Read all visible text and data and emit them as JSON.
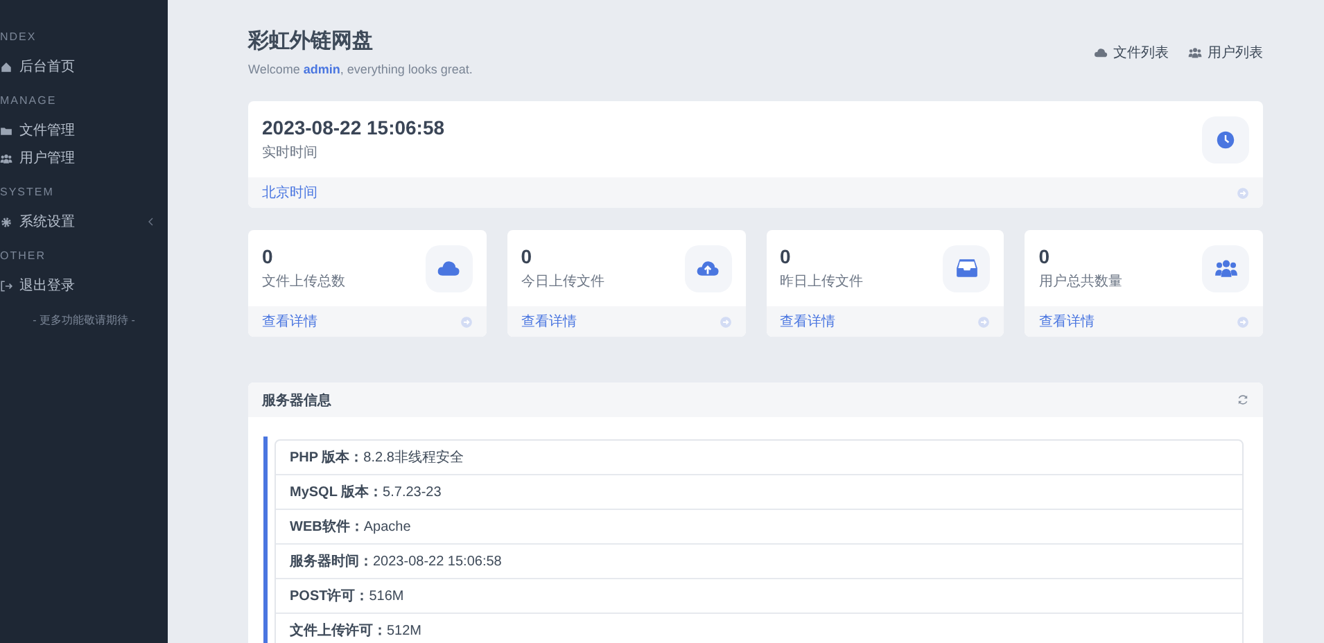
{
  "sidebar": {
    "sections": [
      {
        "heading": "NDEX",
        "items": [
          {
            "label": "后台首页",
            "kind": "home",
            "submenu": false
          }
        ]
      },
      {
        "heading": "MANAGE",
        "items": [
          {
            "label": "文件管理",
            "kind": "folder",
            "submenu": false
          },
          {
            "label": "用户管理",
            "kind": "users",
            "submenu": false
          }
        ]
      },
      {
        "heading": "SYSTEM",
        "items": [
          {
            "label": "系统设置",
            "kind": "gear",
            "submenu": true
          }
        ]
      },
      {
        "heading": "OTHER",
        "items": [
          {
            "label": "退出登录",
            "kind": "logout",
            "submenu": false
          }
        ]
      }
    ],
    "note": "- 更多功能敬请期待 -"
  },
  "header": {
    "title": "彩虹外链网盘",
    "welcome": "Welcome **admin**, everything looks great.",
    "links": [
      {
        "label": "文件列表",
        "kind": "cloud"
      },
      {
        "label": "用户列表",
        "kind": "users"
      }
    ]
  },
  "clock_card": {
    "value": "2023-08-22 15:06:58",
    "label": "实时时间",
    "footer": "北京时间"
  },
  "stats": [
    {
      "value": "0",
      "label": "文件上传总数",
      "footer": "查看详情",
      "kind": "cloud"
    },
    {
      "value": "0",
      "label": "今日上传文件",
      "footer": "查看详情",
      "kind": "upload"
    },
    {
      "value": "0",
      "label": "昨日上传文件",
      "footer": "查看详情",
      "kind": "inbox"
    },
    {
      "value": "0",
      "label": "用户总共数量",
      "footer": "查看详情",
      "kind": "users"
    }
  ],
  "server_info": {
    "title": "服务器信息",
    "rows": [
      "**PHP 版本：**8.2.8非线程安全",
      "**MySQL 版本：**5.7.23-23",
      "**WEB软件：**Apache",
      "**服务器时间：**2023-08-22 15:06:58",
      "**POST许可：**516M",
      "**文件上传许可：**512M"
    ]
  }
}
